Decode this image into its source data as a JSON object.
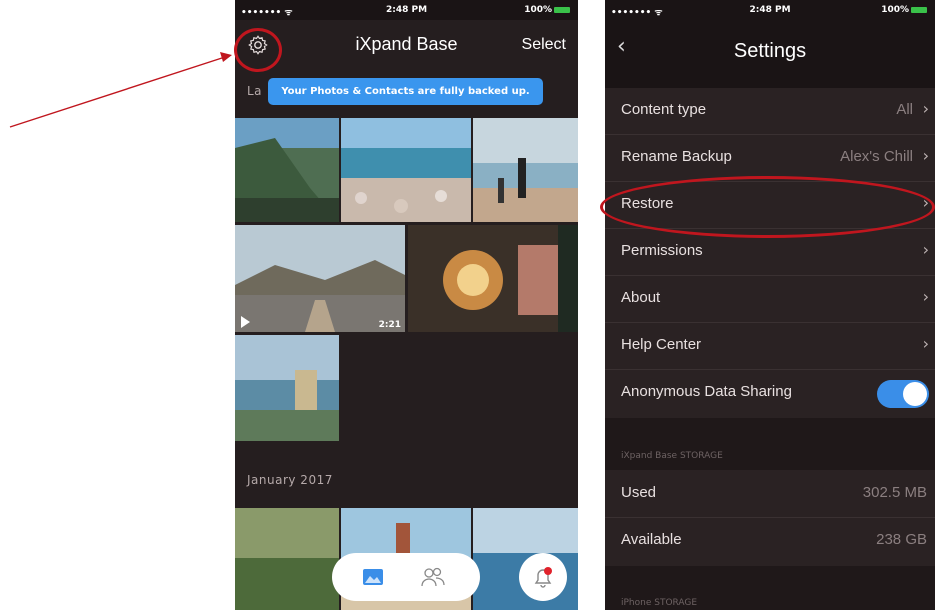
{
  "left": {
    "status": {
      "signal": "••••••• ᯤ",
      "time": "2:48 PM",
      "battery": "100%"
    },
    "title": "iXpand Base",
    "select_label": "Select",
    "section_prefix": "La",
    "toast": "Your Photos & Contacts are fully backed up.",
    "video_duration": "2:21",
    "section_january": "January 2017"
  },
  "right": {
    "status": {
      "signal": "••••••• ᯤ",
      "time": "2:48 PM",
      "battery": "100%"
    },
    "title": "Settings",
    "rows": [
      {
        "label": "Content type",
        "value": "All"
      },
      {
        "label": "Rename Backup",
        "value": "Alex's Chill"
      },
      {
        "label": "Restore",
        "value": ""
      },
      {
        "label": "Permissions",
        "value": ""
      },
      {
        "label": "About",
        "value": ""
      },
      {
        "label": "Help Center",
        "value": ""
      },
      {
        "label": "Anonymous Data Sharing",
        "value": ""
      }
    ],
    "toggle_on": true,
    "storage_header": "iXpand Base STORAGE",
    "storage_rows": [
      {
        "label": "Used",
        "value": "302.5 MB"
      },
      {
        "label": "Available",
        "value": "238 GB"
      }
    ],
    "iphone_header": "iPhone STORAGE"
  },
  "colors": {
    "annotation": "#c0161e",
    "accent": "#3a96ee",
    "toggle": "#3a8ee8"
  }
}
